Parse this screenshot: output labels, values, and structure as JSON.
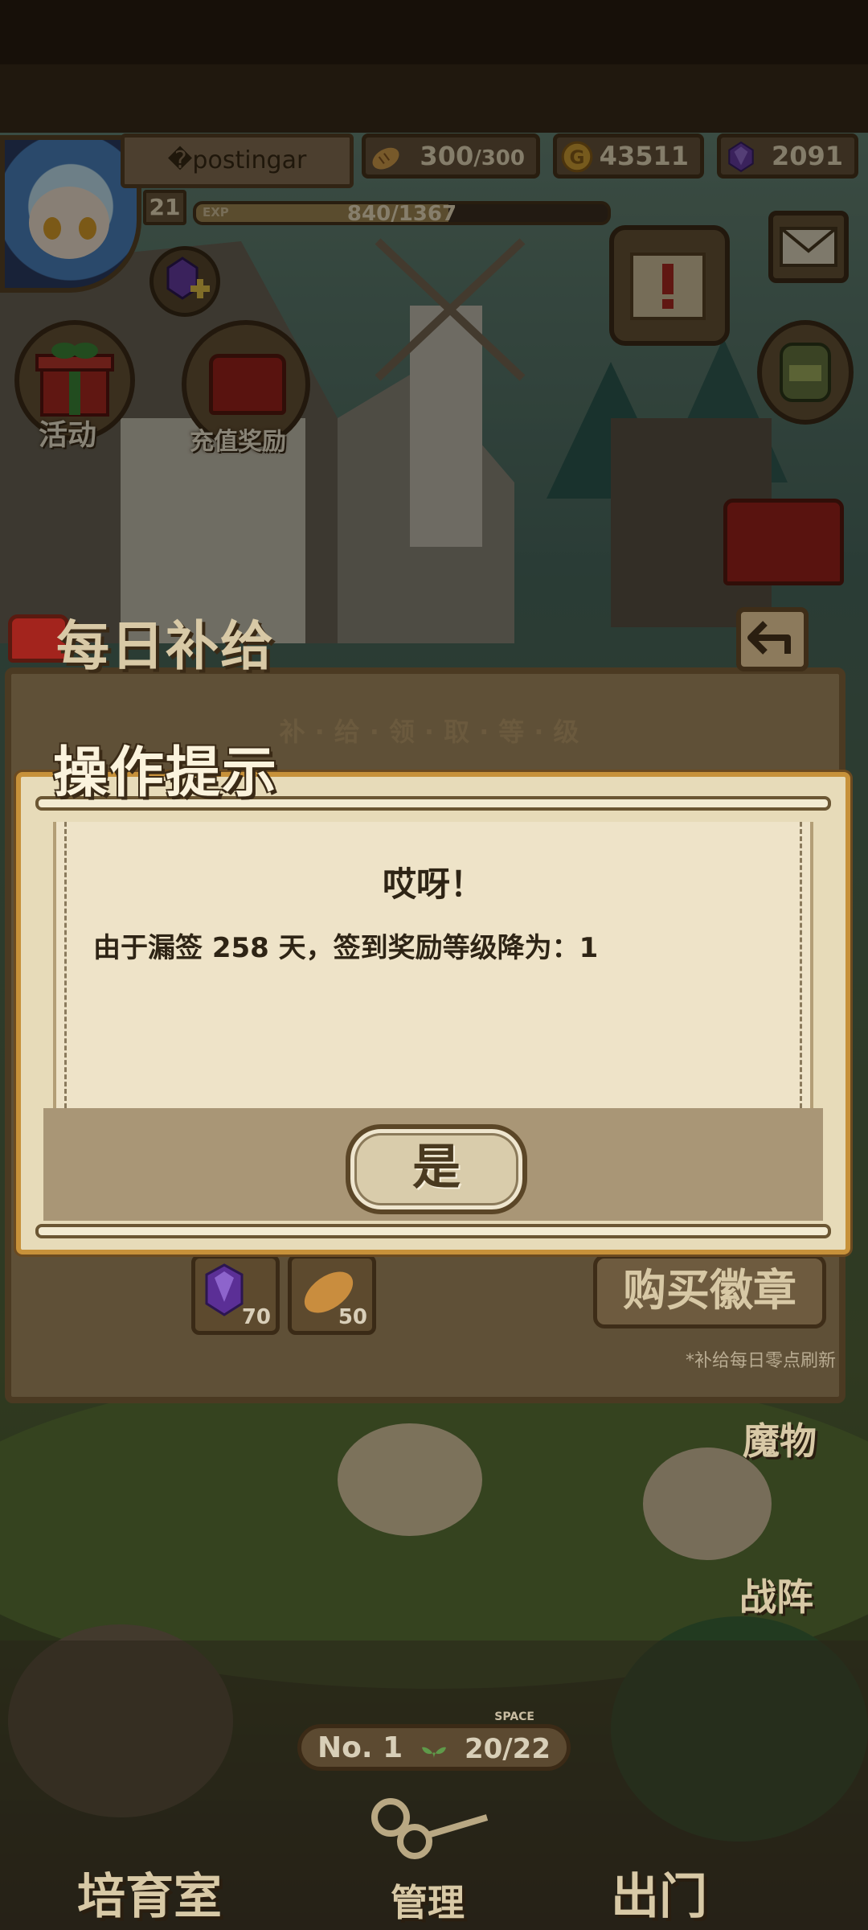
{
  "hud": {
    "player_name": "�postingar",
    "level": "21",
    "exp_label": "EXP",
    "exp_text": "840/1367",
    "exp_progress": 0.614,
    "bread": {
      "current": "300",
      "max": "/300",
      "icon": "bread-icon"
    },
    "gold": {
      "value": "43511",
      "icon": "gold-coin-icon"
    },
    "gems": {
      "value": "2091",
      "icon": "purple-gem-icon"
    }
  },
  "side_buttons": {
    "activity": "活动",
    "recharge_reward": "充值奖励"
  },
  "daily_supply": {
    "title": "每日补给",
    "subtitle": "补·给·领·取·等·级",
    "items": [
      {
        "icon": "purple-gem-icon",
        "count": "70"
      },
      {
        "icon": "bread-icon",
        "count": "50"
      }
    ],
    "buy_button": "购买徽章",
    "refresh_note": "*补给每日零点刷新"
  },
  "dialog": {
    "title": "操作提示",
    "heading": "哎呀！",
    "message": "由于漏签 258 天，签到奖励等级降为：1",
    "confirm_button": "是"
  },
  "scene": {
    "monster_label": "魔物",
    "formation_label": "战阵"
  },
  "bottom_nav": {
    "nursery": "培育室",
    "manage": "管理",
    "go_out": "出门"
  },
  "population": {
    "prefix": "No.",
    "rank": "1",
    "space_label": "SPACE",
    "count": "20/22"
  },
  "colors": {
    "dialog_border": "#c7913a",
    "panel_brown": "#5f5037",
    "paper": "#eee3c8"
  }
}
